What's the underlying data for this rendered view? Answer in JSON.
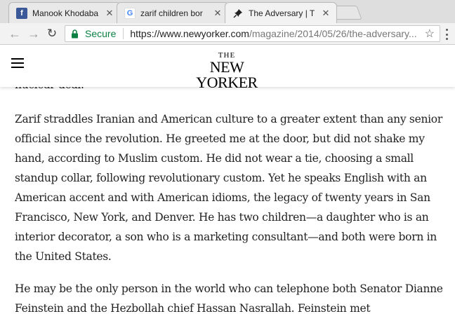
{
  "browser": {
    "tabs": [
      {
        "label": "Manook Khodaba",
        "icon": "facebook-icon",
        "active": false
      },
      {
        "label": "zarif children bor",
        "icon": "google-icon",
        "active": false
      },
      {
        "label": "The Adversary | T",
        "icon": "pin-icon",
        "active": true
      }
    ],
    "omnibox": {
      "secure_label": "Secure",
      "url_host": "https://www.newyorker.com",
      "url_path": "/magazine/2014/05/26/the-adversary..."
    },
    "colors": {
      "secure": "#0b8043",
      "facebook": "#3b5998"
    }
  },
  "site": {
    "logo_top": "THE",
    "logo_name": "NEW YORKER"
  },
  "article": {
    "clipped_text": "nuclear deal.",
    "paragraphs": [
      "Zarif straddles Iranian and American culture to a greater extent than any senior official since the revolution. He greeted me at the door, but did not shake my hand, according to Muslim custom. He did not wear a tie, choosing a small standup collar, following revolutionary custom. Yet he speaks English with an American accent and with American idioms, the legacy of twenty years in San Francisco, New York, and Denver. He has two children—a daughter who is an interior decorator, a son who is a marketing consultant—and both were born in the United States.",
      "He may be the only person in the world who can telephone both Senator Dianne Feinstein and the Hezbollah chief Hassan Nasrallah. Feinstein met"
    ]
  }
}
